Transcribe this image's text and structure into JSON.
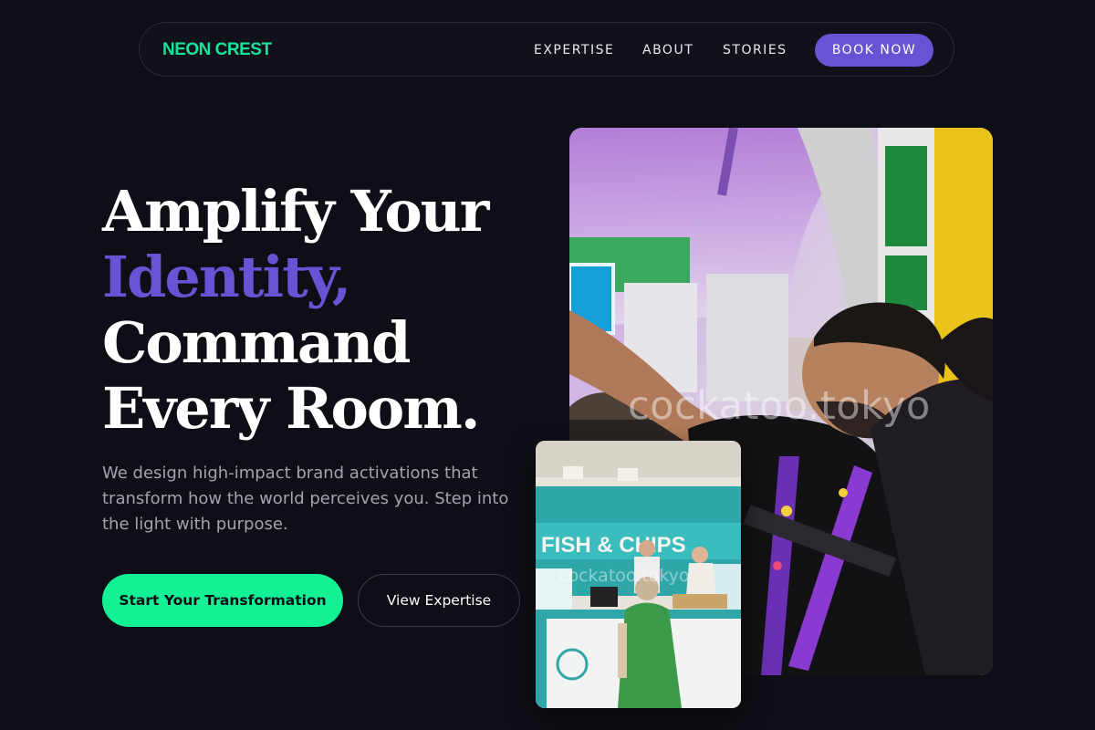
{
  "nav": {
    "brand": "NEON CREST",
    "links": [
      {
        "label": "EXPERTISE"
      },
      {
        "label": "ABOUT"
      },
      {
        "label": "STORIES"
      }
    ],
    "cta_label": "BOOK NOW"
  },
  "hero": {
    "headline_line1": "Amplify Your",
    "headline_accent": "Identity,",
    "headline_line3": "Command",
    "headline_line4": "Every Room.",
    "subtext": "We design high-impact brand activations that transform how the world perceives you. Step into the light with purpose.",
    "primary_cta": "Start Your Transformation",
    "secondary_cta": "View Expertise"
  },
  "images": {
    "main_watermark": "cockatoo.tokyo",
    "card_watermark": "cockatoo.tokyo",
    "card_sign": "FISH & CHIPS"
  },
  "colors": {
    "background": "#0e0e16",
    "brand_green": "#15e39a",
    "accent_purple": "#6a52d4",
    "cta_green": "#12f295",
    "muted_text": "#a2a2b2"
  }
}
